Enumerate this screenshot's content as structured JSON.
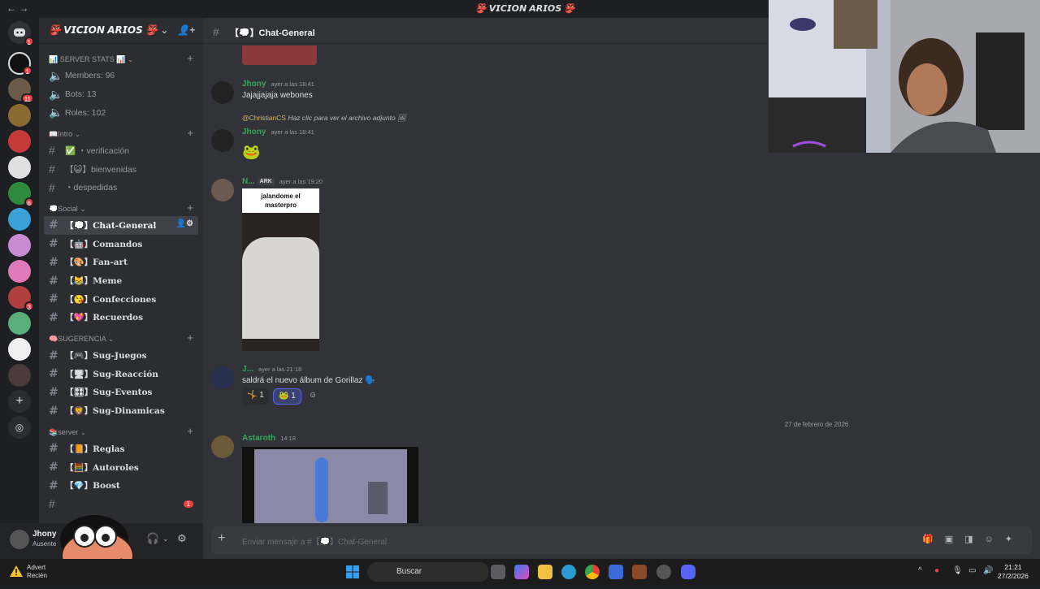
{
  "window": {
    "nav": "←  →",
    "title": "👺 𝙑𝙄𝘾𝙄𝙊𝙉 𝘼𝙍𝙄𝙊𝙎 👺"
  },
  "server_badges": [
    "1",
    "11",
    "6",
    "3"
  ],
  "sidebar": {
    "guild_name": "👺 𝙑𝙄𝘾𝙄𝙊𝙉 𝘼𝙍𝙄𝙊𝙎 👺",
    "categories": {
      "stats": "📊 SERVER STATS 📊 ⌄",
      "intro": "📖Intro ⌄",
      "social": "💭Social ⌄",
      "sugerencia": "🧠SUGERENCIA ⌄",
      "server": "📚server ⌄"
    },
    "stats": {
      "members": "Members: 96",
      "bots": "Bots: 13",
      "roles": "Roles: 102"
    },
    "intro": {
      "verificacion": "✅ ・verificación",
      "bienvenidas": "【😺】bienvenidas",
      "despedidas": "・despedidas"
    },
    "social": {
      "chat_general": "【💭】Chat-General",
      "comandos": "【🤖】Comandos",
      "fan_art": "【🎨】Fan-art",
      "meme": "【😹】Meme",
      "confecciones": "【😘】Confecciones",
      "recuerdos": "【💖】Recuerdos"
    },
    "sugerencia": {
      "juegos": "【🎮】Sug-Juegos",
      "reaccion": "【🖥】Sug-Reacción",
      "eventos": "【🎛】Sug-Eventos",
      "dinamicas": "【🦁】Sug-Dinamicas"
    },
    "server": {
      "reglas": "【📙】Reglas",
      "autoroles": "【🧮】Autoroles",
      "boost": "【💎】Boost"
    },
    "unread_badge": "1"
  },
  "userbar": {
    "name": "Jhony",
    "status": "Ausente"
  },
  "channel": {
    "header": "【💭】Chat-General"
  },
  "messages": {
    "m1": {
      "author": "Jhony",
      "time": "ayer a las 18:41",
      "text": "Jajajjajaja webones"
    },
    "reply": {
      "mention": "@ChristianCS",
      "text": "Haz clic para ver el archivo adjunto"
    },
    "m2": {
      "author": "Jhony",
      "time": "ayer a las 18:41"
    },
    "m3": {
      "author": "N...",
      "tag": "ARK",
      "time": "ayer a las 19:20",
      "image_caption": "jalandome el masterpro"
    },
    "m4": {
      "author": "J...",
      "time": "ayer a las 21:18",
      "text": "saldrá el nuevo álbum de Gorillaz 🗣️"
    },
    "reactions": [
      {
        "emoji": "🤸",
        "count": "1"
      },
      {
        "emoji": "🐸",
        "count": "1"
      }
    ],
    "date_divider": "27 de febrero de 2026",
    "m5": {
      "author": "Astaroth",
      "time": "14:18"
    }
  },
  "composer": {
    "placeholder": "Enviar mensaje a #【💭】Chat-General"
  },
  "taskbar": {
    "warning_line1": "Advert",
    "warning_line2": "Recién",
    "search": "Buscar",
    "time": "21:21",
    "date": "27/2/2026"
  },
  "colors": {
    "accent": "#5865f2",
    "author_green": "#3ba55c",
    "mention": "#dcb45a",
    "badge_red": "#f23f43"
  }
}
